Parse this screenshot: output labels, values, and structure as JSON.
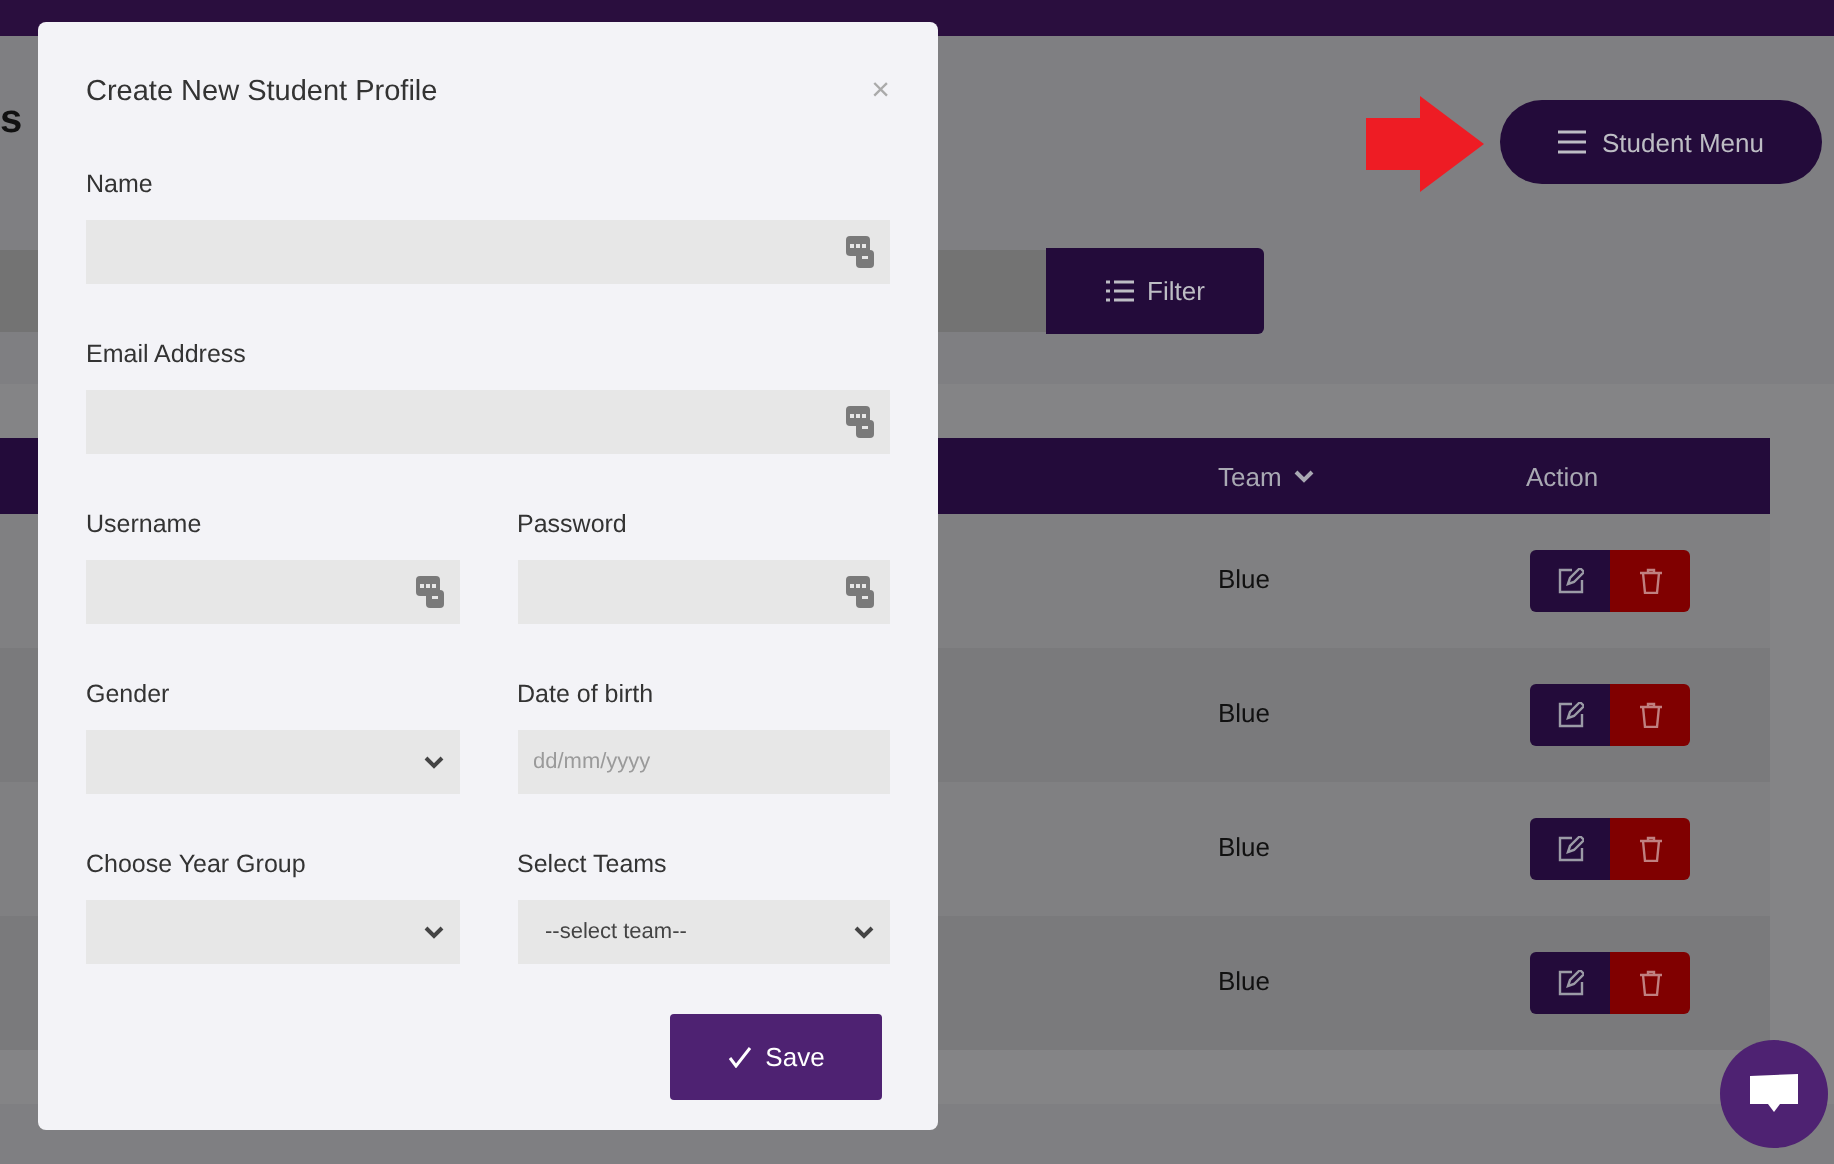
{
  "page": {
    "title": "s",
    "menu_button": "Student Menu",
    "filter_button": "Filter"
  },
  "table": {
    "columns": [
      {
        "label": "Team",
        "sortable": true
      },
      {
        "label": "Action",
        "sortable": false
      }
    ],
    "rows": [
      {
        "team": "Blue"
      },
      {
        "team": "Blue"
      },
      {
        "team": "Blue"
      },
      {
        "team": "Blue"
      }
    ]
  },
  "modal": {
    "title": "Create New Student Profile",
    "close": "×",
    "save_button": "Save",
    "rows": [
      [
        {
          "label": "Name",
          "kind": "text"
        }
      ],
      [
        {
          "label": "Email Address",
          "kind": "text"
        }
      ],
      [
        {
          "label": "Username",
          "kind": "text"
        },
        {
          "label": "Password",
          "kind": "text"
        }
      ],
      [
        {
          "label": "Gender",
          "kind": "select"
        },
        {
          "label": "Date of birth",
          "kind": "date",
          "placeholder": "dd/mm/yyyy"
        }
      ],
      [
        {
          "label": "Choose Year Group",
          "kind": "select"
        },
        {
          "label": "Select Teams",
          "kind": "select",
          "value": "--select team--"
        }
      ]
    ]
  }
}
